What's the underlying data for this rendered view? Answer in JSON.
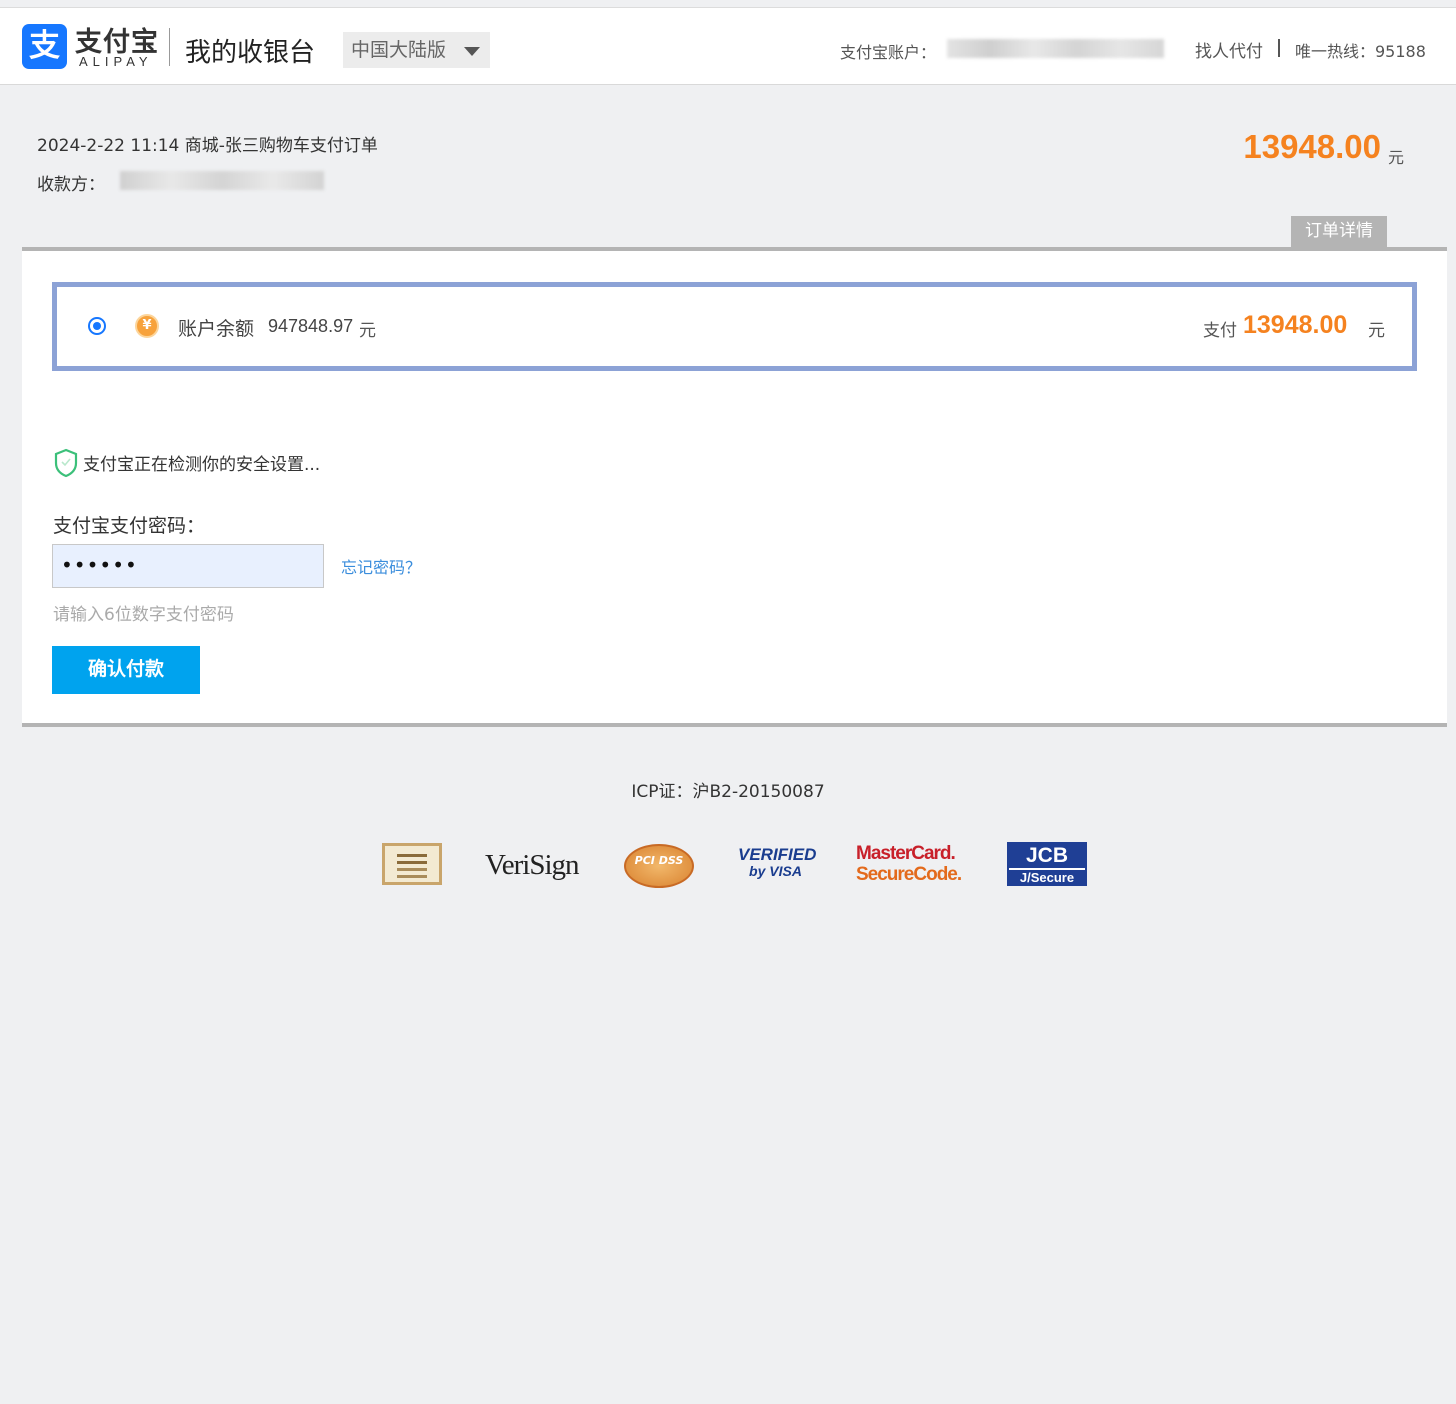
{
  "header": {
    "logo_glyph": "支",
    "logo_text": "支付宝",
    "logo_sub": "ALIPAY",
    "title": "我的收银台",
    "region_select": "中国大陆版",
    "account_label": "支付宝账户：",
    "proxy_pay_link": "找人代付",
    "hotline": "唯一热线：95188"
  },
  "order": {
    "title": "2024-2-22 11:14 商城-张三购物车支付订单",
    "payee_label": "收款方：",
    "total_amount": "13948.00",
    "total_unit": "元",
    "detail_tab": "订单详情"
  },
  "payment_method": {
    "selected": true,
    "icon": "yen-coin-icon",
    "balance_label": "账户余额",
    "balance_value": "947848.97",
    "balance_unit": "元",
    "pay_label": "支付",
    "pay_amount": "13948.00",
    "pay_unit": "元"
  },
  "security": {
    "icon": "shield-icon",
    "message": "支付宝正在检测你的安全设置..."
  },
  "password": {
    "label": "支付宝支付密码：",
    "value": "••••••",
    "forgot_link": "忘记密码？",
    "hint": "请输入6位数字支付密码",
    "confirm_button": "确认付款"
  },
  "footer": {
    "icp": "ICP证：沪B2-20150087",
    "badges": {
      "verisign": "VeriSign",
      "pci": "PCI DSS",
      "visa_line1": "VERIFIED",
      "visa_line2": "by VISA",
      "mastercard_line1": "MasterCard.",
      "mastercard_line2": "SecureCode.",
      "jcb_line1": "JCB",
      "jcb_line2": "J/Secure"
    }
  },
  "colors": {
    "brand_blue": "#1677ff",
    "amount_orange": "#f5821f",
    "button_blue": "#00a3ee",
    "method_border": "#8ca2d6",
    "link_blue": "#3a8ddc"
  }
}
